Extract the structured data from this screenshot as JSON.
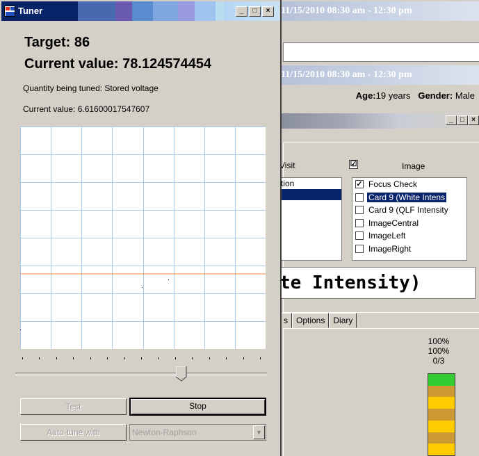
{
  "background_window": {
    "title_1": "11/15/2010 08:30 am - 12:30 pm",
    "title_2": "11/15/2010 08:30 am - 12:30 pm",
    "age_label": "Age:",
    "age_value": "19 years",
    "gender_label": "Gender:",
    "gender_value": "Male",
    "visit_label": "Visit",
    "image_label": "Image",
    "image_checkbox": "☑",
    "visit_items": [
      "tion",
      ""
    ],
    "image_items": [
      {
        "label": "Focus Check",
        "checked": true
      },
      {
        "label": "Card 9 (White Intens",
        "checked": false
      },
      {
        "label": "Card 9 (QLF Intensity",
        "checked": false
      },
      {
        "label": "ImageCentral",
        "checked": false
      },
      {
        "label": "ImageLeft",
        "checked": false
      },
      {
        "label": "ImageRight",
        "checked": false
      }
    ],
    "big_text": "te Intensity)",
    "tabs": [
      "s",
      "Options",
      "Diary"
    ],
    "percent_1": "100%",
    "percent_2": "100%",
    "fraction": "0/3",
    "meter_colors": [
      "#33cc33",
      "#cc9933",
      "#ffcc00",
      "#cc9933",
      "#ffcc00",
      "#cc9933",
      "#ffcc00"
    ]
  },
  "dialog": {
    "title": "Tuner",
    "minimize_glyph": "_",
    "maximize_glyph": "□",
    "close_glyph": "×",
    "target_text": "Target: 86",
    "current_value_big": "Current value: 78.124574454",
    "quantity_text": "Quantity being tuned: Stored voltage",
    "current_value_small": "Current value: 6.61600017547607",
    "test_button": "Test",
    "stop_button": "Stop",
    "autotune_button": "Auto-tune with",
    "method_value": "Newton-Raphson",
    "slider_value": 0.66,
    "slider_tick_count": 15
  },
  "colors": {
    "title_active": "#0a246a",
    "grid": "#a6caf0",
    "target_line": "#ff8040",
    "selection": "#0a246a"
  }
}
